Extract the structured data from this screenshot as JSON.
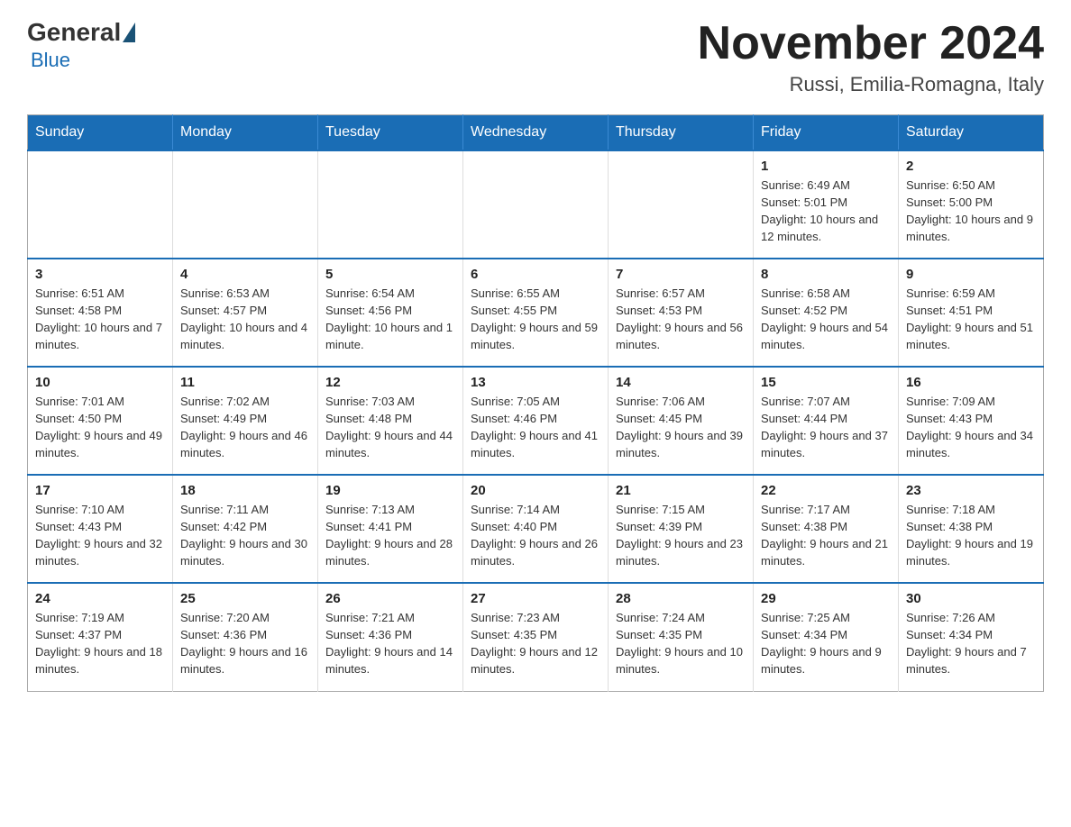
{
  "header": {
    "logo_general": "General",
    "logo_blue": "Blue",
    "title": "November 2024",
    "location": "Russi, Emilia-Romagna, Italy"
  },
  "calendar": {
    "days_of_week": [
      "Sunday",
      "Monday",
      "Tuesday",
      "Wednesday",
      "Thursday",
      "Friday",
      "Saturday"
    ],
    "weeks": [
      [
        {
          "day": "",
          "info": ""
        },
        {
          "day": "",
          "info": ""
        },
        {
          "day": "",
          "info": ""
        },
        {
          "day": "",
          "info": ""
        },
        {
          "day": "",
          "info": ""
        },
        {
          "day": "1",
          "info": "Sunrise: 6:49 AM\nSunset: 5:01 PM\nDaylight: 10 hours and 12 minutes."
        },
        {
          "day": "2",
          "info": "Sunrise: 6:50 AM\nSunset: 5:00 PM\nDaylight: 10 hours and 9 minutes."
        }
      ],
      [
        {
          "day": "3",
          "info": "Sunrise: 6:51 AM\nSunset: 4:58 PM\nDaylight: 10 hours and 7 minutes."
        },
        {
          "day": "4",
          "info": "Sunrise: 6:53 AM\nSunset: 4:57 PM\nDaylight: 10 hours and 4 minutes."
        },
        {
          "day": "5",
          "info": "Sunrise: 6:54 AM\nSunset: 4:56 PM\nDaylight: 10 hours and 1 minute."
        },
        {
          "day": "6",
          "info": "Sunrise: 6:55 AM\nSunset: 4:55 PM\nDaylight: 9 hours and 59 minutes."
        },
        {
          "day": "7",
          "info": "Sunrise: 6:57 AM\nSunset: 4:53 PM\nDaylight: 9 hours and 56 minutes."
        },
        {
          "day": "8",
          "info": "Sunrise: 6:58 AM\nSunset: 4:52 PM\nDaylight: 9 hours and 54 minutes."
        },
        {
          "day": "9",
          "info": "Sunrise: 6:59 AM\nSunset: 4:51 PM\nDaylight: 9 hours and 51 minutes."
        }
      ],
      [
        {
          "day": "10",
          "info": "Sunrise: 7:01 AM\nSunset: 4:50 PM\nDaylight: 9 hours and 49 minutes."
        },
        {
          "day": "11",
          "info": "Sunrise: 7:02 AM\nSunset: 4:49 PM\nDaylight: 9 hours and 46 minutes."
        },
        {
          "day": "12",
          "info": "Sunrise: 7:03 AM\nSunset: 4:48 PM\nDaylight: 9 hours and 44 minutes."
        },
        {
          "day": "13",
          "info": "Sunrise: 7:05 AM\nSunset: 4:46 PM\nDaylight: 9 hours and 41 minutes."
        },
        {
          "day": "14",
          "info": "Sunrise: 7:06 AM\nSunset: 4:45 PM\nDaylight: 9 hours and 39 minutes."
        },
        {
          "day": "15",
          "info": "Sunrise: 7:07 AM\nSunset: 4:44 PM\nDaylight: 9 hours and 37 minutes."
        },
        {
          "day": "16",
          "info": "Sunrise: 7:09 AM\nSunset: 4:43 PM\nDaylight: 9 hours and 34 minutes."
        }
      ],
      [
        {
          "day": "17",
          "info": "Sunrise: 7:10 AM\nSunset: 4:43 PM\nDaylight: 9 hours and 32 minutes."
        },
        {
          "day": "18",
          "info": "Sunrise: 7:11 AM\nSunset: 4:42 PM\nDaylight: 9 hours and 30 minutes."
        },
        {
          "day": "19",
          "info": "Sunrise: 7:13 AM\nSunset: 4:41 PM\nDaylight: 9 hours and 28 minutes."
        },
        {
          "day": "20",
          "info": "Sunrise: 7:14 AM\nSunset: 4:40 PM\nDaylight: 9 hours and 26 minutes."
        },
        {
          "day": "21",
          "info": "Sunrise: 7:15 AM\nSunset: 4:39 PM\nDaylight: 9 hours and 23 minutes."
        },
        {
          "day": "22",
          "info": "Sunrise: 7:17 AM\nSunset: 4:38 PM\nDaylight: 9 hours and 21 minutes."
        },
        {
          "day": "23",
          "info": "Sunrise: 7:18 AM\nSunset: 4:38 PM\nDaylight: 9 hours and 19 minutes."
        }
      ],
      [
        {
          "day": "24",
          "info": "Sunrise: 7:19 AM\nSunset: 4:37 PM\nDaylight: 9 hours and 18 minutes."
        },
        {
          "day": "25",
          "info": "Sunrise: 7:20 AM\nSunset: 4:36 PM\nDaylight: 9 hours and 16 minutes."
        },
        {
          "day": "26",
          "info": "Sunrise: 7:21 AM\nSunset: 4:36 PM\nDaylight: 9 hours and 14 minutes."
        },
        {
          "day": "27",
          "info": "Sunrise: 7:23 AM\nSunset: 4:35 PM\nDaylight: 9 hours and 12 minutes."
        },
        {
          "day": "28",
          "info": "Sunrise: 7:24 AM\nSunset: 4:35 PM\nDaylight: 9 hours and 10 minutes."
        },
        {
          "day": "29",
          "info": "Sunrise: 7:25 AM\nSunset: 4:34 PM\nDaylight: 9 hours and 9 minutes."
        },
        {
          "day": "30",
          "info": "Sunrise: 7:26 AM\nSunset: 4:34 PM\nDaylight: 9 hours and 7 minutes."
        }
      ]
    ]
  }
}
